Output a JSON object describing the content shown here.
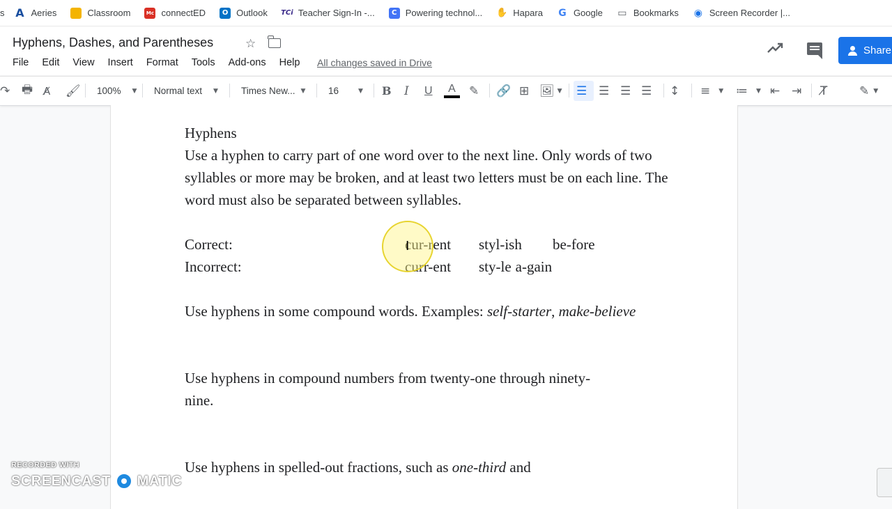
{
  "bookmarks": [
    {
      "label": "s",
      "icon": "none"
    },
    {
      "label": "Aeries",
      "icon": "aeries-icon"
    },
    {
      "label": "Classroom",
      "icon": "classroom-icon"
    },
    {
      "label": "connectED",
      "icon": "connected-icon"
    },
    {
      "label": "Outlook",
      "icon": "outlook-icon"
    },
    {
      "label": "Teacher Sign-In -...",
      "icon": "tci-icon"
    },
    {
      "label": "Powering technol...",
      "icon": "clever-icon"
    },
    {
      "label": "Hapara",
      "icon": "hapara-icon"
    },
    {
      "label": "Google",
      "icon": "google-icon"
    },
    {
      "label": "Bookmarks",
      "icon": "folder-icon"
    },
    {
      "label": "Screen Recorder |...",
      "icon": "screen-recorder-icon"
    }
  ],
  "header": {
    "title": "Hyphens, Dashes, and Parentheses",
    "menu": [
      "File",
      "Edit",
      "View",
      "Insert",
      "Format",
      "Tools",
      "Add-ons",
      "Help"
    ],
    "saved_status": "All changes saved in Drive",
    "share_label": "Share"
  },
  "toolbar": {
    "zoom": "100%",
    "style": "Normal text",
    "font": "Times New...",
    "font_size": "16",
    "bold": "B",
    "italic": "I",
    "underline": "U",
    "text_color": "A"
  },
  "doc": {
    "heading": "Hyphens",
    "para1": "Use a hyphen to carry part of one word over to the next line. Only words of two syllables or more may be broken, and at least two letters must be on each line. The word must also be separated between syllables.",
    "correct_label": "Correct:",
    "correct_words": [
      "cur-rent",
      "styl-ish",
      "be-fore"
    ],
    "incorrect_label": "Incorrect:",
    "incorrect_words": [
      "curr-ent",
      "sty-le",
      "a-gain"
    ],
    "para2_text": "Use hyphens in some compound words. Examples: ",
    "para2_ex1": "self-starter",
    "para2_comma": ",",
    "para2_ex2": "make-believe",
    "para3": "Use hyphens in compound numbers from twenty-one through ninety-nine.",
    "para4_text": "Use hyphens in spelled-out fractions, such as ",
    "para4_ex1": "one-third",
    "para4_and": " and"
  },
  "watermark": {
    "top": "RECORDED WITH",
    "left": "SCREENCAST",
    "right": "MATIC"
  },
  "colors": {
    "accent": "#1a73e8",
    "active_align_bg": "#e8f0fe",
    "cursor_highlight": "#fff582"
  }
}
